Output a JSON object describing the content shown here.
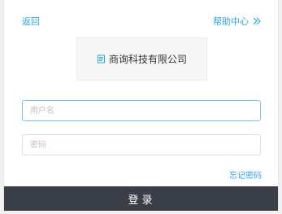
{
  "header": {
    "back_label": "返回",
    "help_label": "帮助中心"
  },
  "company": {
    "name": "商询科技有限公司",
    "icon": "document-icon"
  },
  "form": {
    "username_placeholder": "用户名",
    "password_placeholder": "密码",
    "forgot_label": "忘记密码",
    "login_label": "登录"
  },
  "colors": {
    "accent": "#2aa6e6",
    "button_bg": "#3a3f47",
    "focus_border": "#7dc3ee"
  }
}
